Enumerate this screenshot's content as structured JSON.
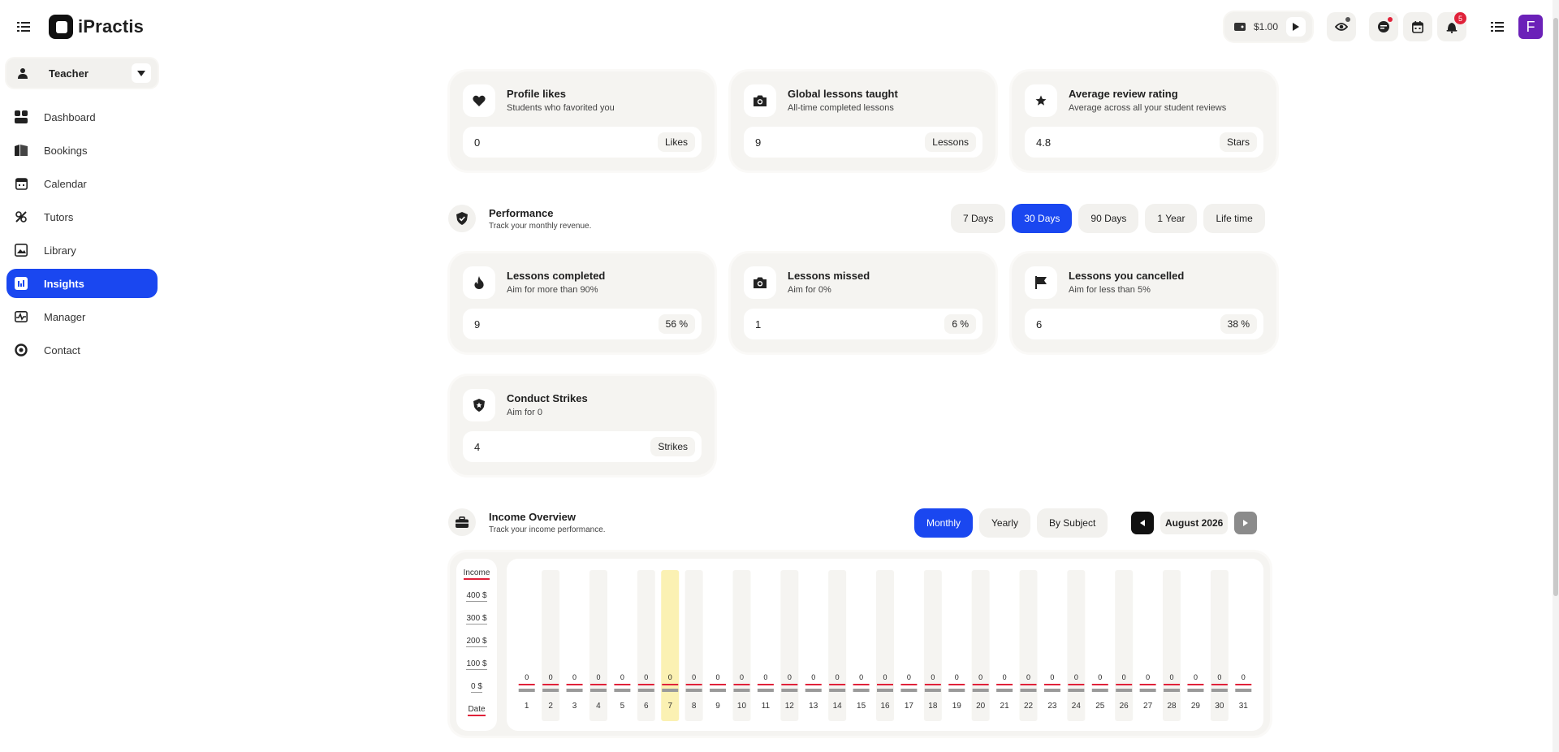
{
  "app": {
    "name": "iPractis"
  },
  "topbar": {
    "wallet_amount": "$1.00",
    "notifications_count": "5",
    "avatar_initial": "F"
  },
  "role": {
    "label": "Teacher"
  },
  "sidebar": {
    "items": [
      {
        "label": "Dashboard",
        "icon": "dashboard-icon"
      },
      {
        "label": "Bookings",
        "icon": "bookings-icon"
      },
      {
        "label": "Calendar",
        "icon": "calendar-icon"
      },
      {
        "label": "Tutors",
        "icon": "tutors-icon"
      },
      {
        "label": "Library",
        "icon": "library-icon"
      },
      {
        "label": "Insights",
        "icon": "insights-icon",
        "active": true
      },
      {
        "label": "Manager",
        "icon": "manager-icon"
      },
      {
        "label": "Contact",
        "icon": "contact-icon"
      }
    ]
  },
  "stats": [
    {
      "title": "Profile likes",
      "subtitle": "Students who favorited you",
      "value": "0",
      "unit": "Likes",
      "icon": "heart-icon"
    },
    {
      "title": "Global lessons taught",
      "subtitle": "All-time completed lessons",
      "value": "9",
      "unit": "Lessons",
      "icon": "camera-icon"
    },
    {
      "title": "Average review rating",
      "subtitle": "Average across all your student reviews",
      "value": "4.8",
      "unit": "Stars",
      "icon": "star-icon"
    }
  ],
  "performance": {
    "title": "Performance",
    "subtitle": "Track your monthly revenue.",
    "ranges": [
      "7 Days",
      "30 Days",
      "90 Days",
      "1 Year",
      "Life time"
    ],
    "active_range": "30 Days",
    "cards": [
      {
        "title": "Lessons completed",
        "subtitle": "Aim for more than 90%",
        "value": "9",
        "unit": "56 %",
        "icon": "flame-icon"
      },
      {
        "title": "Lessons missed",
        "subtitle": "Aim for 0%",
        "value": "1",
        "unit": "6 %",
        "icon": "camera-icon"
      },
      {
        "title": "Lessons you cancelled",
        "subtitle": "Aim for less than 5%",
        "value": "6",
        "unit": "38 %",
        "icon": "flag-icon"
      },
      {
        "title": "Conduct Strikes",
        "subtitle": "Aim for 0",
        "value": "4",
        "unit": "Strikes",
        "icon": "shield-star-icon"
      }
    ]
  },
  "income": {
    "title": "Income Overview",
    "subtitle": "Track your income performance.",
    "tabs": [
      "Monthly",
      "Yearly",
      "By Subject"
    ],
    "active_tab": "Monthly",
    "month": "August 2026",
    "y_header": "Income",
    "x_header": "Date"
  },
  "chart_data": {
    "type": "bar",
    "title": "Income Overview",
    "ylabel": "Income",
    "xlabel": "Date",
    "yticks": [
      "400 $",
      "300 $",
      "200 $",
      "100 $",
      "0 $"
    ],
    "ylim": [
      0,
      400
    ],
    "highlighted_category": "7",
    "categories": [
      "1",
      "2",
      "3",
      "4",
      "5",
      "6",
      "7",
      "8",
      "9",
      "10",
      "11",
      "12",
      "13",
      "14",
      "15",
      "16",
      "17",
      "18",
      "19",
      "20",
      "21",
      "22",
      "23",
      "24",
      "25",
      "26",
      "27",
      "28",
      "29",
      "30",
      "31"
    ],
    "values": [
      0,
      0,
      0,
      0,
      0,
      0,
      0,
      0,
      0,
      0,
      0,
      0,
      0,
      0,
      0,
      0,
      0,
      0,
      0,
      0,
      0,
      0,
      0,
      0,
      0,
      0,
      0,
      0,
      0,
      0,
      0
    ],
    "colors": {
      "highlight": "#fbf1b3",
      "track": "#f5f4f1",
      "baseline": "#e0223a",
      "bar": "#9a9a9a"
    }
  }
}
